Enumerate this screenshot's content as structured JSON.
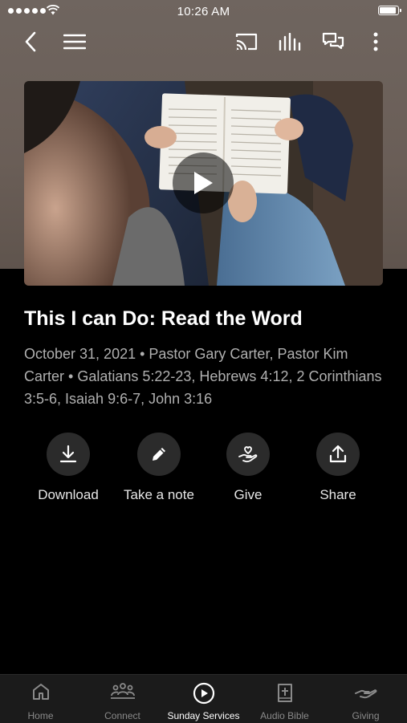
{
  "status_bar": {
    "time": "10:26 AM"
  },
  "sermon": {
    "title": "This I can Do:  Read the Word",
    "meta": "October 31, 2021 • Pastor Gary Carter, Pastor Kim Carter • Galatians 5:22-23, Hebrews 4:12, 2 Corinthians 3:5-6, Isaiah 9:6-7, John 3:16"
  },
  "actions": [
    {
      "label": "Download",
      "icon": "download-icon"
    },
    {
      "label": "Take a note",
      "icon": "pencil-icon"
    },
    {
      "label": "Give",
      "icon": "give-icon"
    },
    {
      "label": "Share",
      "icon": "share-icon"
    }
  ],
  "tabs": [
    {
      "label": "Home",
      "icon": "home-icon"
    },
    {
      "label": "Connect",
      "icon": "connect-icon"
    },
    {
      "label": "Sunday Services",
      "icon": "play-circle-icon"
    },
    {
      "label": "Audio Bible",
      "icon": "bible-icon"
    },
    {
      "label": "Giving",
      "icon": "giving-icon"
    }
  ],
  "colors": {
    "background": "#000000",
    "tab_bar": "#1b1b1b",
    "muted_text": "#b0b0b0",
    "action_circle": "#2b2b2b"
  }
}
